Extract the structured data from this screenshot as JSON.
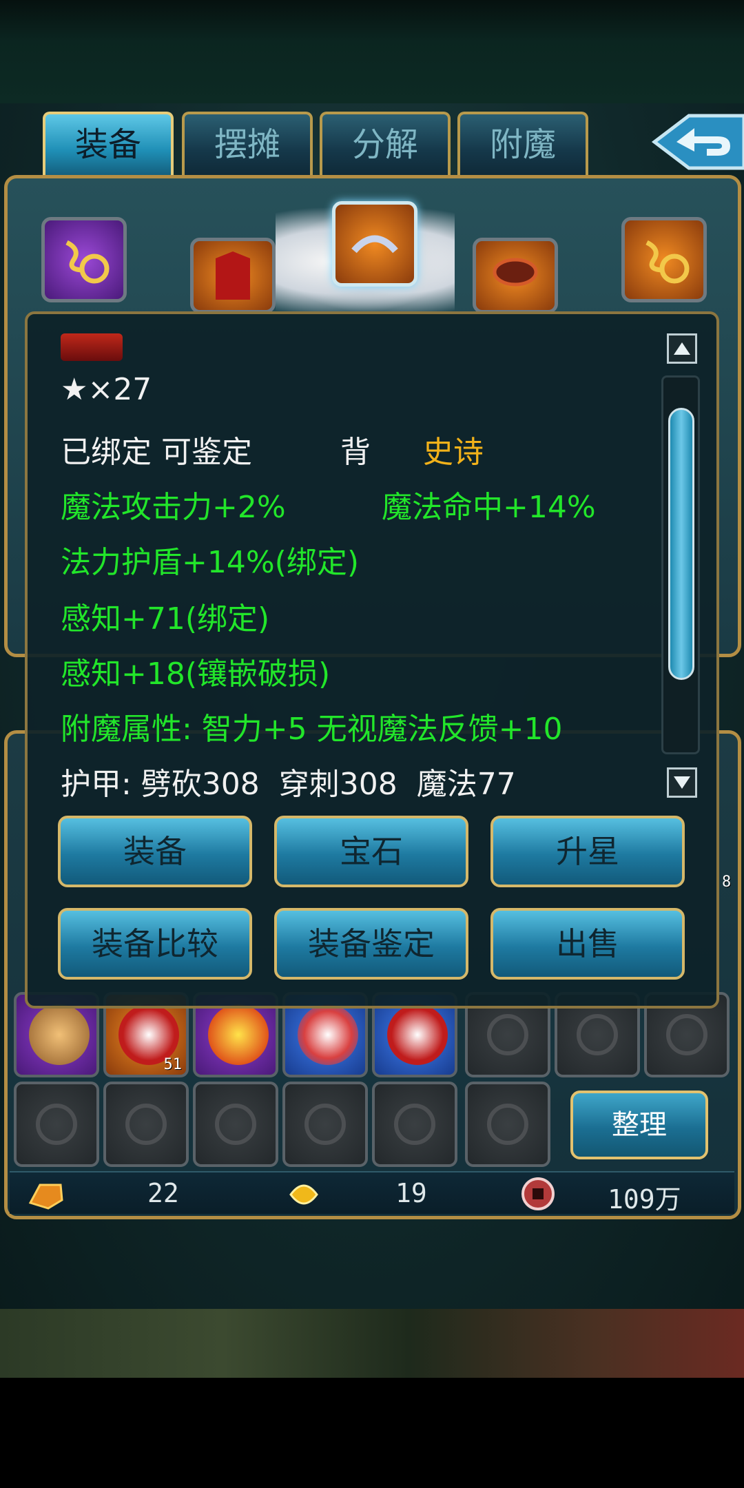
{
  "tabs": [
    {
      "label": "装备",
      "active": true
    },
    {
      "label": "摆摊",
      "active": false
    },
    {
      "label": "分解",
      "active": false
    },
    {
      "label": "附魔",
      "active": false
    }
  ],
  "item_detail": {
    "stars": "★×27",
    "status_line": "已绑定 可鉴定",
    "slot_type": "背",
    "rarity": "史诗",
    "attr_line1_a": "魔法攻击力+2%",
    "attr_line1_b": "魔法命中+14%",
    "attr_line2": "法力护盾+14%(绑定)",
    "attr_line3": "感知+71(绑定)",
    "attr_line4": "感知+18(镶嵌破损)",
    "enchant_line": "附魔属性: 智力+5 无视魔法反馈+10",
    "armor_line": "护甲: 劈砍308  穿刺308  魔法77"
  },
  "actions": {
    "equip": "装备",
    "gem": "宝石",
    "star_up": "升星",
    "compare": "装备比较",
    "identify": "装备鉴定",
    "sell": "出售"
  },
  "inventory": {
    "sort_label": "整理",
    "stack_count": "51",
    "side_count": "8"
  },
  "currency": {
    "gold": "22",
    "leaf": "19",
    "coins": "109万"
  },
  "colors": {
    "attr_green": "#22e62a",
    "rarity_gold": "#f2b21a",
    "panel_border": "#b48e44"
  }
}
